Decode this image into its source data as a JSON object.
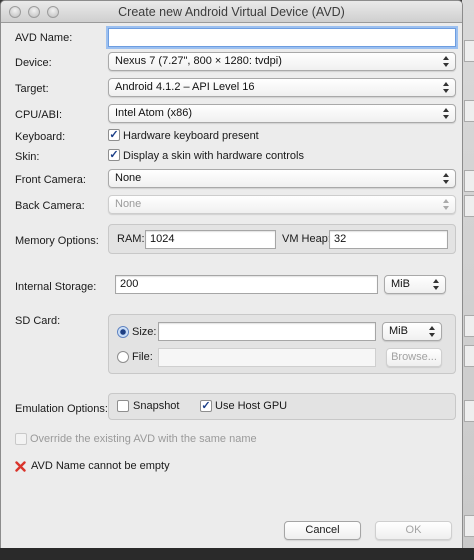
{
  "window": {
    "title": "Create new Android Virtual Device (AVD)"
  },
  "form": {
    "avd_name_label": "AVD Name:",
    "avd_name_value": "",
    "device_label": "Device:",
    "device_value": "Nexus 7 (7.27\", 800 × 1280: tvdpi)",
    "target_label": "Target:",
    "target_value": "Android 4.1.2 – API Level 16",
    "cpu_label": "CPU/ABI:",
    "cpu_value": "Intel Atom (x86)",
    "keyboard_label": "Keyboard:",
    "keyboard_checkbox": "Hardware keyboard present",
    "keyboard_checked": true,
    "skin_label": "Skin:",
    "skin_checkbox": "Display a skin with hardware controls",
    "skin_checked": true,
    "front_camera_label": "Front Camera:",
    "front_camera_value": "None",
    "back_camera_label": "Back Camera:",
    "back_camera_value": "None",
    "memory_label": "Memory Options:",
    "ram_label": "RAM:",
    "ram_value": "1024",
    "vm_heap_label": "VM Heap:",
    "vm_heap_value": "32",
    "internal_storage_label": "Internal Storage:",
    "internal_storage_value": "200",
    "internal_storage_unit": "MiB",
    "sd_card_label": "SD Card:",
    "sd_size_label": "Size:",
    "sd_size_value": "",
    "sd_size_unit": "MiB",
    "sd_size_selected": true,
    "sd_file_label": "File:",
    "sd_file_value": "",
    "browse_label": "Browse...",
    "emulation_label": "Emulation Options:",
    "snapshot_label": "Snapshot",
    "snapshot_checked": false,
    "host_gpu_label": "Use Host GPU",
    "host_gpu_checked": true,
    "override_label": "Override the existing AVD with the same name",
    "override_checked": false,
    "error_message": "AVD Name cannot be empty"
  },
  "buttons": {
    "cancel": "Cancel",
    "ok": "OK"
  },
  "colors": {
    "accent": "#6d9de0",
    "error": "#d9342b",
    "check": "#1c3f88"
  },
  "icons": {
    "error": "error-x-icon",
    "check": "checkmark-icon",
    "arrows": "up-down-arrows-icon"
  }
}
